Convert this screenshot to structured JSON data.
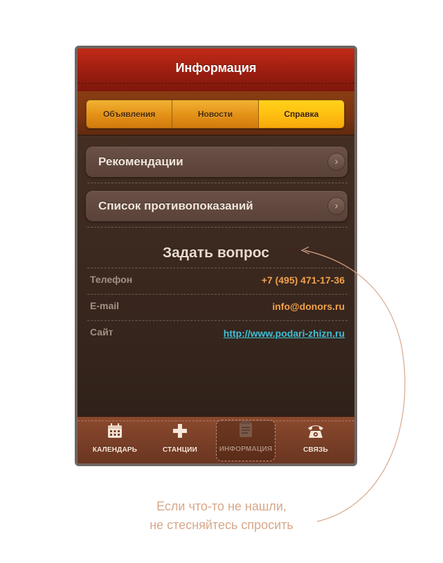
{
  "header": {
    "title": "Информация"
  },
  "segments": {
    "items": [
      {
        "label": "Объявления",
        "active": false
      },
      {
        "label": "Новости",
        "active": false
      },
      {
        "label": "Справка",
        "active": true
      }
    ]
  },
  "menu": {
    "items": [
      {
        "label": "Рекомендации",
        "icon": "chevron-right-icon"
      },
      {
        "label": "Список противопоказаний",
        "icon": "chevron-right-icon"
      }
    ]
  },
  "contacts": {
    "heading": "Задать вопрос",
    "phone_label": "Телефон",
    "phone_value": "+7 (495) 471-17-36",
    "email_label": "E-mail",
    "email_value": "info@donors.ru",
    "site_label": "Сайт",
    "site_value": "http://www.podari-zhizn.ru"
  },
  "tabbar": {
    "items": [
      {
        "label": "КАЛЕНДАРЬ",
        "icon": "calendar-icon",
        "active": false
      },
      {
        "label": "СТАНЦИИ",
        "icon": "plus-icon",
        "active": false
      },
      {
        "label": "ИНФОРМАЦИЯ",
        "icon": "notepad-icon",
        "active": true
      },
      {
        "label": "СВЯЗЬ",
        "icon": "phone-icon",
        "active": false
      }
    ]
  },
  "caption": {
    "line1": "Если что-то не нашли,",
    "line2": "не стесняйтесь спросить"
  },
  "colors": {
    "header_red": "#9c1e10",
    "segment_orange": "#e39016",
    "segment_active": "#ffbe10",
    "accent_orange": "#f2a24a",
    "link_cyan": "#3ec0d6",
    "caption": "#d8a789"
  }
}
